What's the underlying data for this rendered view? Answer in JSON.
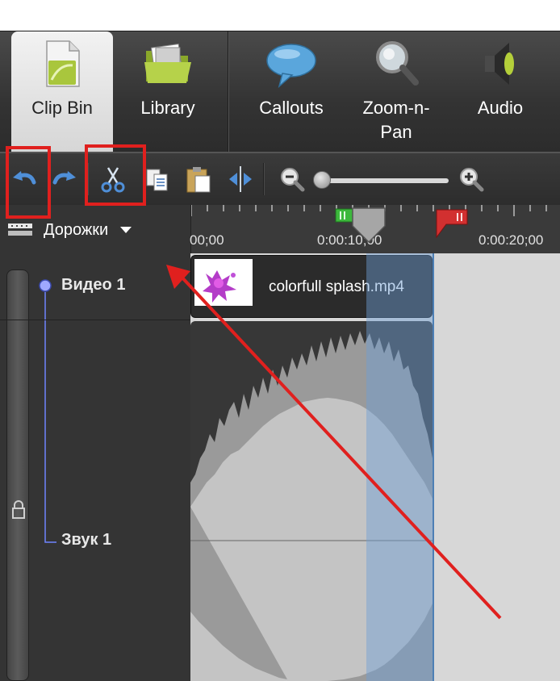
{
  "tabs": [
    {
      "label": "Clip Bin",
      "icon": "clip-bin-icon",
      "active": true
    },
    {
      "label": "Library",
      "icon": "folder-icon",
      "active": false
    },
    {
      "label": "Callouts",
      "icon": "speech-bubble-icon",
      "active": false
    },
    {
      "label": "Zoom-n-\nPan",
      "icon": "magnifier-icon",
      "active": false
    },
    {
      "label": "Audio",
      "icon": "speaker-icon",
      "active": false
    }
  ],
  "toolbar": {
    "buttons": [
      "undo-icon",
      "redo-icon",
      "scissors-icon",
      "copy-icon",
      "paste-icon",
      "split-icon",
      "zoom-out-icon",
      "zoom-in-icon"
    ],
    "zoom_level": 0.05
  },
  "tracks_menu": {
    "label": "Дорожки"
  },
  "ruler": {
    "timecodes": [
      "00;00",
      "0:00:10;00",
      "0:00:20;00"
    ]
  },
  "tracks": [
    {
      "name": "Видео 1"
    },
    {
      "name": "Звук 1"
    }
  ],
  "clip": {
    "name": "colorfull splash.mp4"
  },
  "colors": {
    "annotation_red": "#e0201e",
    "selection_blue": "#6ea0d7",
    "marker_green": "#3cb83c",
    "marker_red": "#d23030"
  }
}
